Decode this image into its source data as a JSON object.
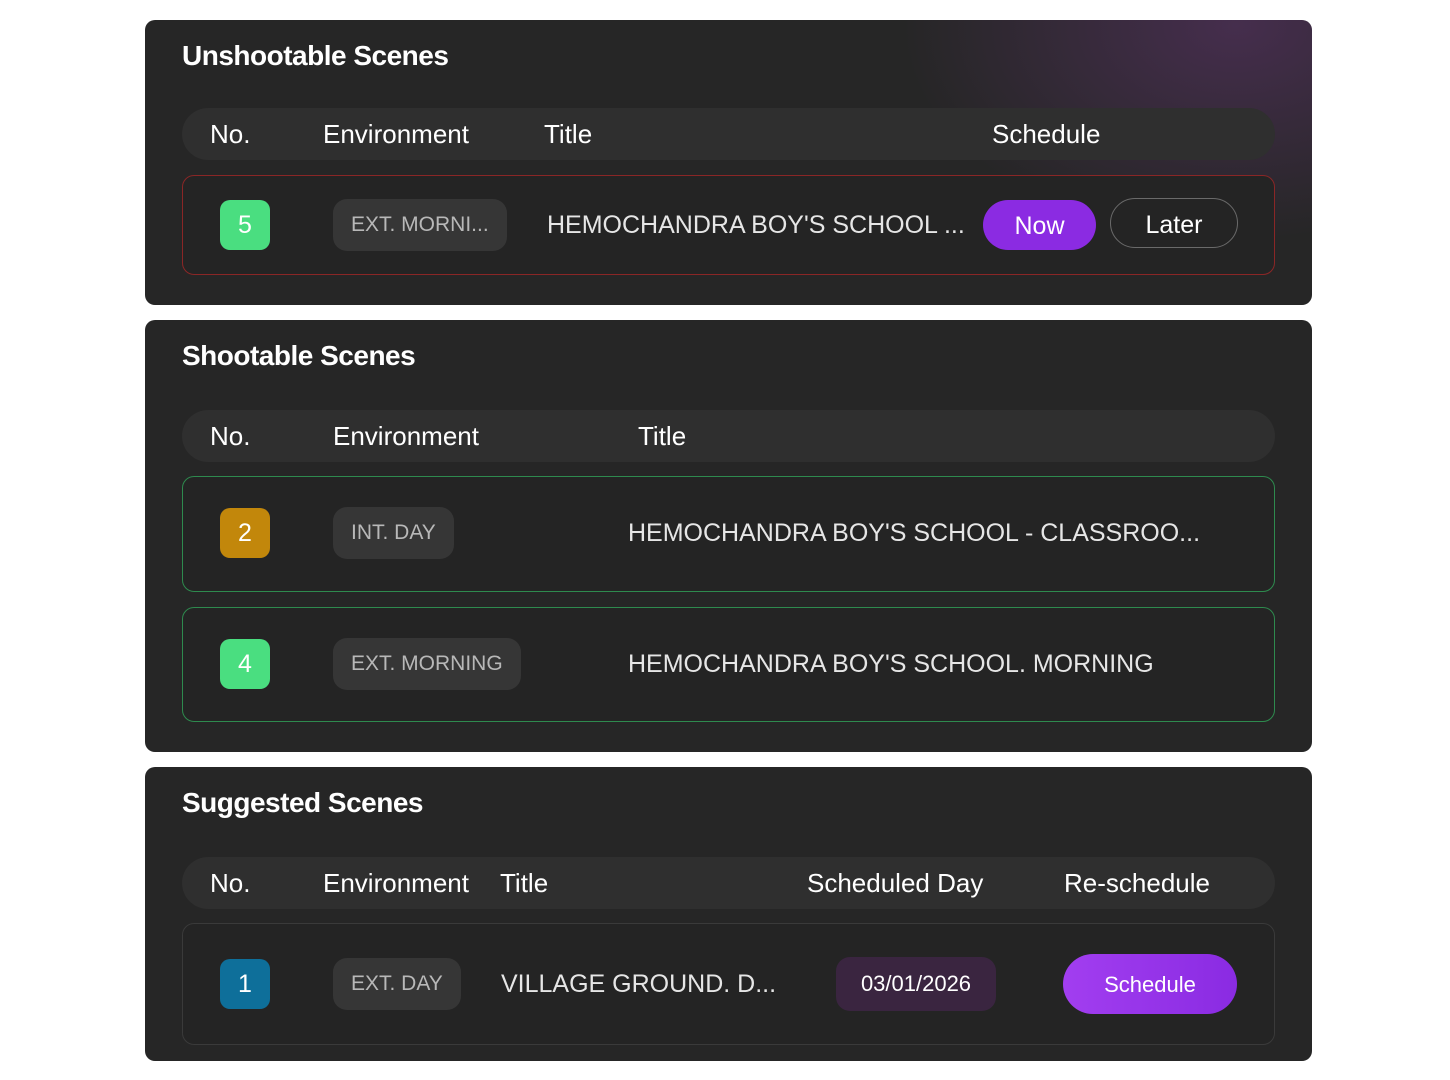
{
  "colors": {
    "panel_bg": "#262626",
    "header_bg": "#2f2f2f",
    "accent_purple": "#8b2be2",
    "badge_green": "#4ade80",
    "badge_amber": "#c2870b",
    "badge_blue": "#0e6f9a",
    "row_border_red": "#8a2626",
    "row_border_green": "#2e8a4e"
  },
  "unshootable": {
    "title": "Unshootable Scenes",
    "headers": {
      "no": "No.",
      "environment": "Environment",
      "title": "Title",
      "schedule": "Schedule"
    },
    "rows": [
      {
        "no": "5",
        "environment": "EXT. MORNI...",
        "title": "HEMOCHANDRA BOY'S SCHOOL ...",
        "now_label": "Now",
        "later_label": "Later"
      }
    ]
  },
  "shootable": {
    "title": "Shootable Scenes",
    "headers": {
      "no": "No.",
      "environment": "Environment",
      "title": "Title"
    },
    "rows": [
      {
        "no": "2",
        "environment": "INT. DAY",
        "title": "HEMOCHANDRA BOY'S SCHOOL - CLASSROO..."
      },
      {
        "no": "4",
        "environment": "EXT. MORNING",
        "title": "HEMOCHANDRA BOY'S SCHOOL. MORNING"
      }
    ]
  },
  "suggested": {
    "title": "Suggested Scenes",
    "headers": {
      "no": "No.",
      "environment": "Environment",
      "title": "Title",
      "scheduled_day": "Scheduled Day",
      "reschedule": "Re-schedule"
    },
    "rows": [
      {
        "no": "1",
        "environment": "EXT. DAY",
        "title": "VILLAGE GROUND. D...",
        "scheduled_day": "03/01/2026",
        "schedule_label": "Schedule"
      }
    ]
  }
}
